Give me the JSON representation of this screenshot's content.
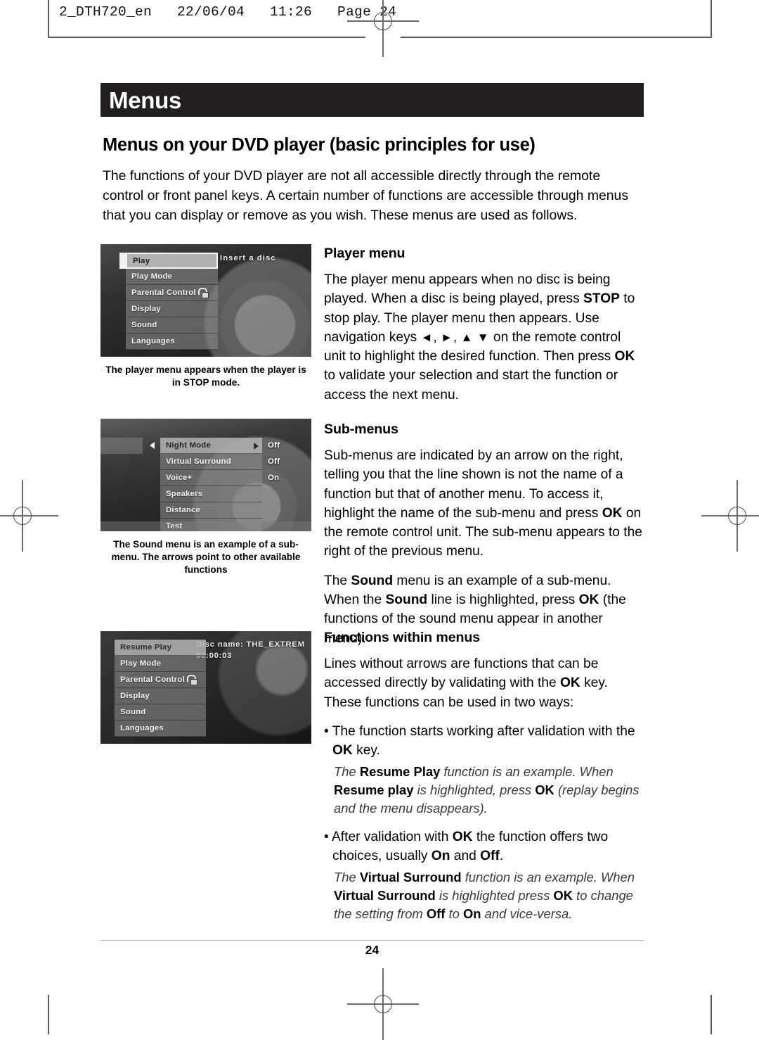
{
  "prepress": {
    "header_line": "2_DTH720_en   22/06/04   11:26   Page 24"
  },
  "chapter": {
    "banner_title": "Menus"
  },
  "page_title": "Menus on your DVD player (basic principles for use)",
  "intro": "The functions of your DVD player are not all accessible directly through the remote control or front panel keys. A certain number of functions are accessible through menus that you can display or remove as you wish. These menus are used as follows.",
  "figures": [
    {
      "name": "player-menu-screenshot",
      "side_text": "Insert a disc",
      "items": [
        {
          "label": "Play",
          "state": "selected",
          "icon": null,
          "value": null
        },
        {
          "label": "Play Mode",
          "state": "normal",
          "icon": null,
          "value": null
        },
        {
          "label": "Parental Control",
          "state": "normal",
          "icon": "lock-icon",
          "value": null
        },
        {
          "label": "Display",
          "state": "normal",
          "icon": null,
          "value": null
        },
        {
          "label": "Sound",
          "state": "normal",
          "icon": null,
          "value": null
        },
        {
          "label": "Languages",
          "state": "normal",
          "icon": null,
          "value": null
        }
      ],
      "caption": "The player menu appears when the player is in STOP mode."
    },
    {
      "name": "sound-submenu-screenshot",
      "side_text": "",
      "items": [
        {
          "label": "Night Mode",
          "state": "selected-soft",
          "icon": null,
          "value": "Off"
        },
        {
          "label": "Virtual Surround",
          "state": "normal",
          "icon": null,
          "value": "Off"
        },
        {
          "label": "Voice+",
          "state": "normal",
          "icon": null,
          "value": "On"
        },
        {
          "label": "Speakers",
          "state": "normal",
          "icon": null,
          "value": null
        },
        {
          "label": "Distance",
          "state": "normal",
          "icon": null,
          "value": null
        },
        {
          "label": "Test",
          "state": "normal",
          "icon": null,
          "value": null
        }
      ],
      "caption": "The Sound menu is an example of a sub-menu. The arrows point to other available functions"
    },
    {
      "name": "resume-play-screenshot",
      "side_text": "Disc name: THE_EXTREM",
      "side_text_2": "00:00:03",
      "items": [
        {
          "label": "Resume Play",
          "state": "selected-soft",
          "icon": null,
          "value": null
        },
        {
          "label": "Play Mode",
          "state": "normal",
          "icon": null,
          "value": null
        },
        {
          "label": "Parental Control",
          "state": "normal",
          "icon": "lock-icon",
          "value": null
        },
        {
          "label": "Display",
          "state": "normal",
          "icon": null,
          "value": null
        },
        {
          "label": "Sound",
          "state": "normal",
          "icon": null,
          "value": null
        },
        {
          "label": "Languages",
          "state": "normal",
          "icon": null,
          "value": null
        }
      ],
      "caption": ""
    }
  ],
  "sections": {
    "player_menu": {
      "heading": "Player menu",
      "paragraph_html": "The player menu appears when no disc is being played. When a disc is being played, press <b>STOP</b> to stop play. The player menu then appears. Use navigation keys <span class=\"navglyph\">◄</span>, <span class=\"navglyph\">►</span>, <span class=\"navglyph\">▲</span> <span class=\"navglyph\">▼</span> on the remote control unit to highlight the desired function. Then press <b>OK</b> to validate your selection and start the function or access the next menu."
    },
    "sub_menus": {
      "heading": "Sub-menus",
      "paragraph_1_html": "Sub-menus are indicated by an arrow on the right, telling you that the line shown is not the name of a function but that of another menu. To access it, highlight the name of the sub-menu and press <b>OK</b> on the remote control unit. The sub-menu appears to the right of the previous menu.",
      "paragraph_2_html": "The <b>Sound</b> menu is an example of a sub-menu. When the <b>Sound</b> line is highlighted, press <b>OK</b> (the functions of the sound menu appear in another menu)."
    },
    "functions_within_menus": {
      "heading": "Functions within menus",
      "paragraph_html": "Lines without arrows are functions that can be accessed directly by validating with the <b>OK</b> key. These functions can be used in two ways:",
      "bullet_1_html": "• The function starts working after validation with the <b>OK</b> key.",
      "example_1_html": "The <b>Resume Play</b> function is an example. When <b>Resume play</b> is highlighted, press <b>OK</b> (replay begins and the menu disappears).",
      "bullet_2_html": "• After validation with <b>OK</b> the function offers two choices, usually <b>On</b> and <b>Off</b>.",
      "example_2_html": "The <b>Virtual Surround</b> function is an example. When <b>Virtual Surround</b> is highlighted press <b>OK</b> to change the setting from <b>Off</b> to <b>On</b> and vice-versa."
    }
  },
  "footer": {
    "page_number": "24"
  },
  "colors": {
    "banner_background": "#231f20",
    "page_background": "#ffffff",
    "text": "#000000",
    "crop_mark": "#5a5a5a"
  }
}
